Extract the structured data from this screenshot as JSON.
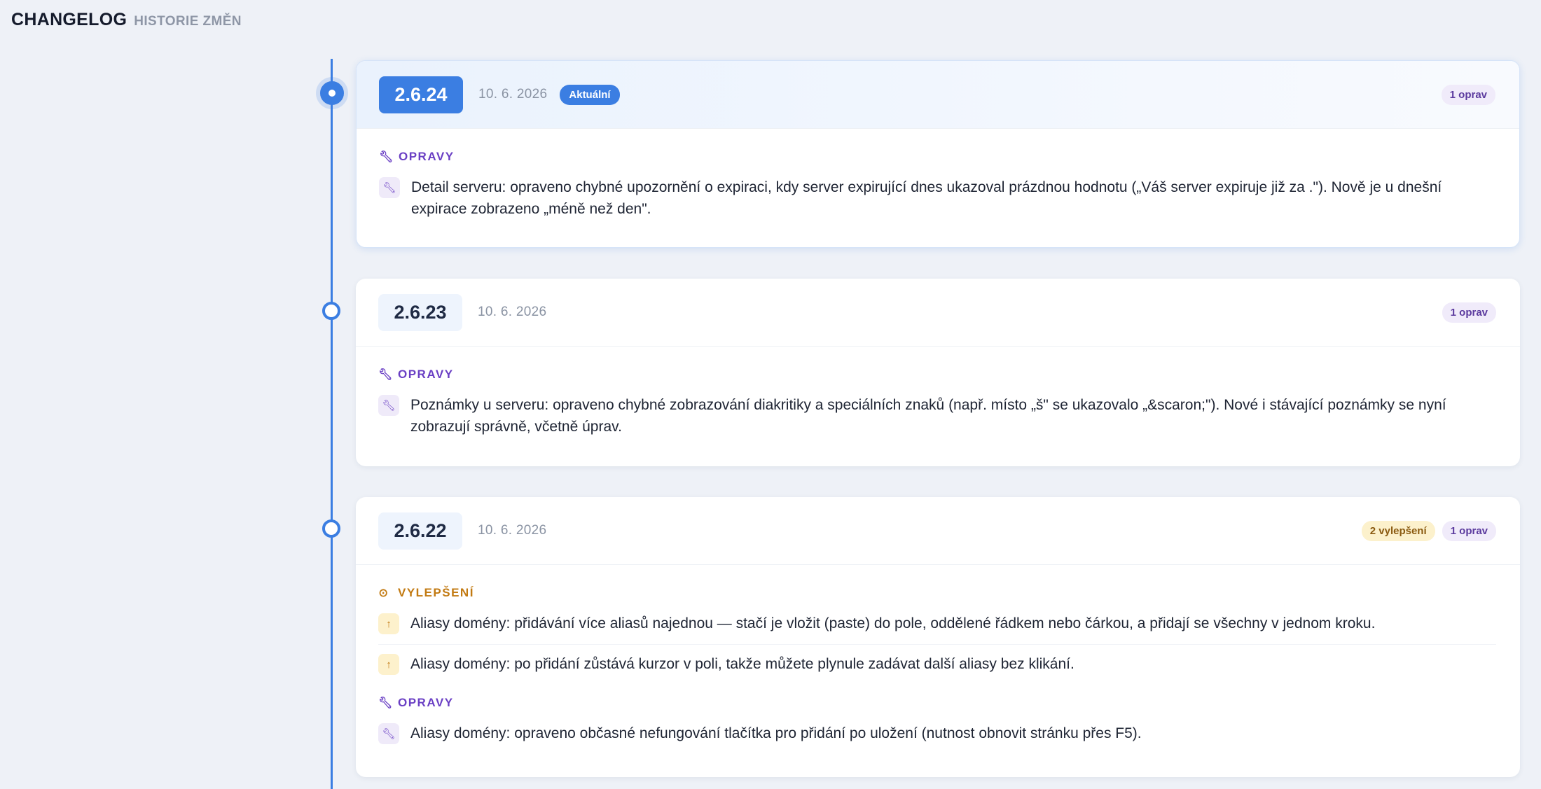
{
  "header": {
    "title": "CHANGELOG",
    "subtitle": "HISTORIE ZMĚN"
  },
  "icons": {
    "fix": "wrench-icon",
    "improvement": "arrow-up-icon",
    "improvement_section": "circle-arrow-up-icon"
  },
  "colors": {
    "accent": "#3b7ee2",
    "fix": "#6a3fc4",
    "improvement": "#c27a12",
    "background": "#eef1f7"
  },
  "releases": [
    {
      "version": "2.6.24",
      "date": "10. 6. 2026",
      "current_label": "Aktuální",
      "counts": {
        "fixes": "1 oprav"
      },
      "fixes_title": "OPRAVY",
      "fixes": [
        "Detail serveru: opraveno chybné upozornění o expiraci, kdy server expirující dnes ukazoval prázdnou hodnotu („Váš server expiruje již za .\"). Nově je u dnešní expirace zobrazeno „méně než den\"."
      ]
    },
    {
      "version": "2.6.23",
      "date": "10. 6. 2026",
      "counts": {
        "fixes": "1 oprav"
      },
      "fixes_title": "OPRAVY",
      "fixes": [
        "Poznámky u serveru: opraveno chybné zobrazování diakritiky a speciálních znaků (např. místo „š\" se ukazovalo „&scaron;\"). Nové i stávající poznámky se nyní zobrazují správně, včetně úprav."
      ]
    },
    {
      "version": "2.6.22",
      "date": "10. 6. 2026",
      "counts": {
        "improvements": "2 vylepšení",
        "fixes": "1 oprav"
      },
      "improvements_title": "VYLEPŠENÍ",
      "improvements": [
        "Aliasy domény: přidávání více aliasů najednou — stačí je vložit (paste) do pole, oddělené řádkem nebo čárkou, a přidají se všechny v jednom kroku.",
        "Aliasy domény: po přidání zůstává kurzor v poli, takže můžete plynule zadávat další aliasy bez klikání."
      ],
      "fixes_title": "OPRAVY",
      "fixes": [
        "Aliasy domény: opraveno občasné nefungování tlačítka pro přidání po uložení (nutnost obnovit stránku přes F5)."
      ]
    }
  ]
}
